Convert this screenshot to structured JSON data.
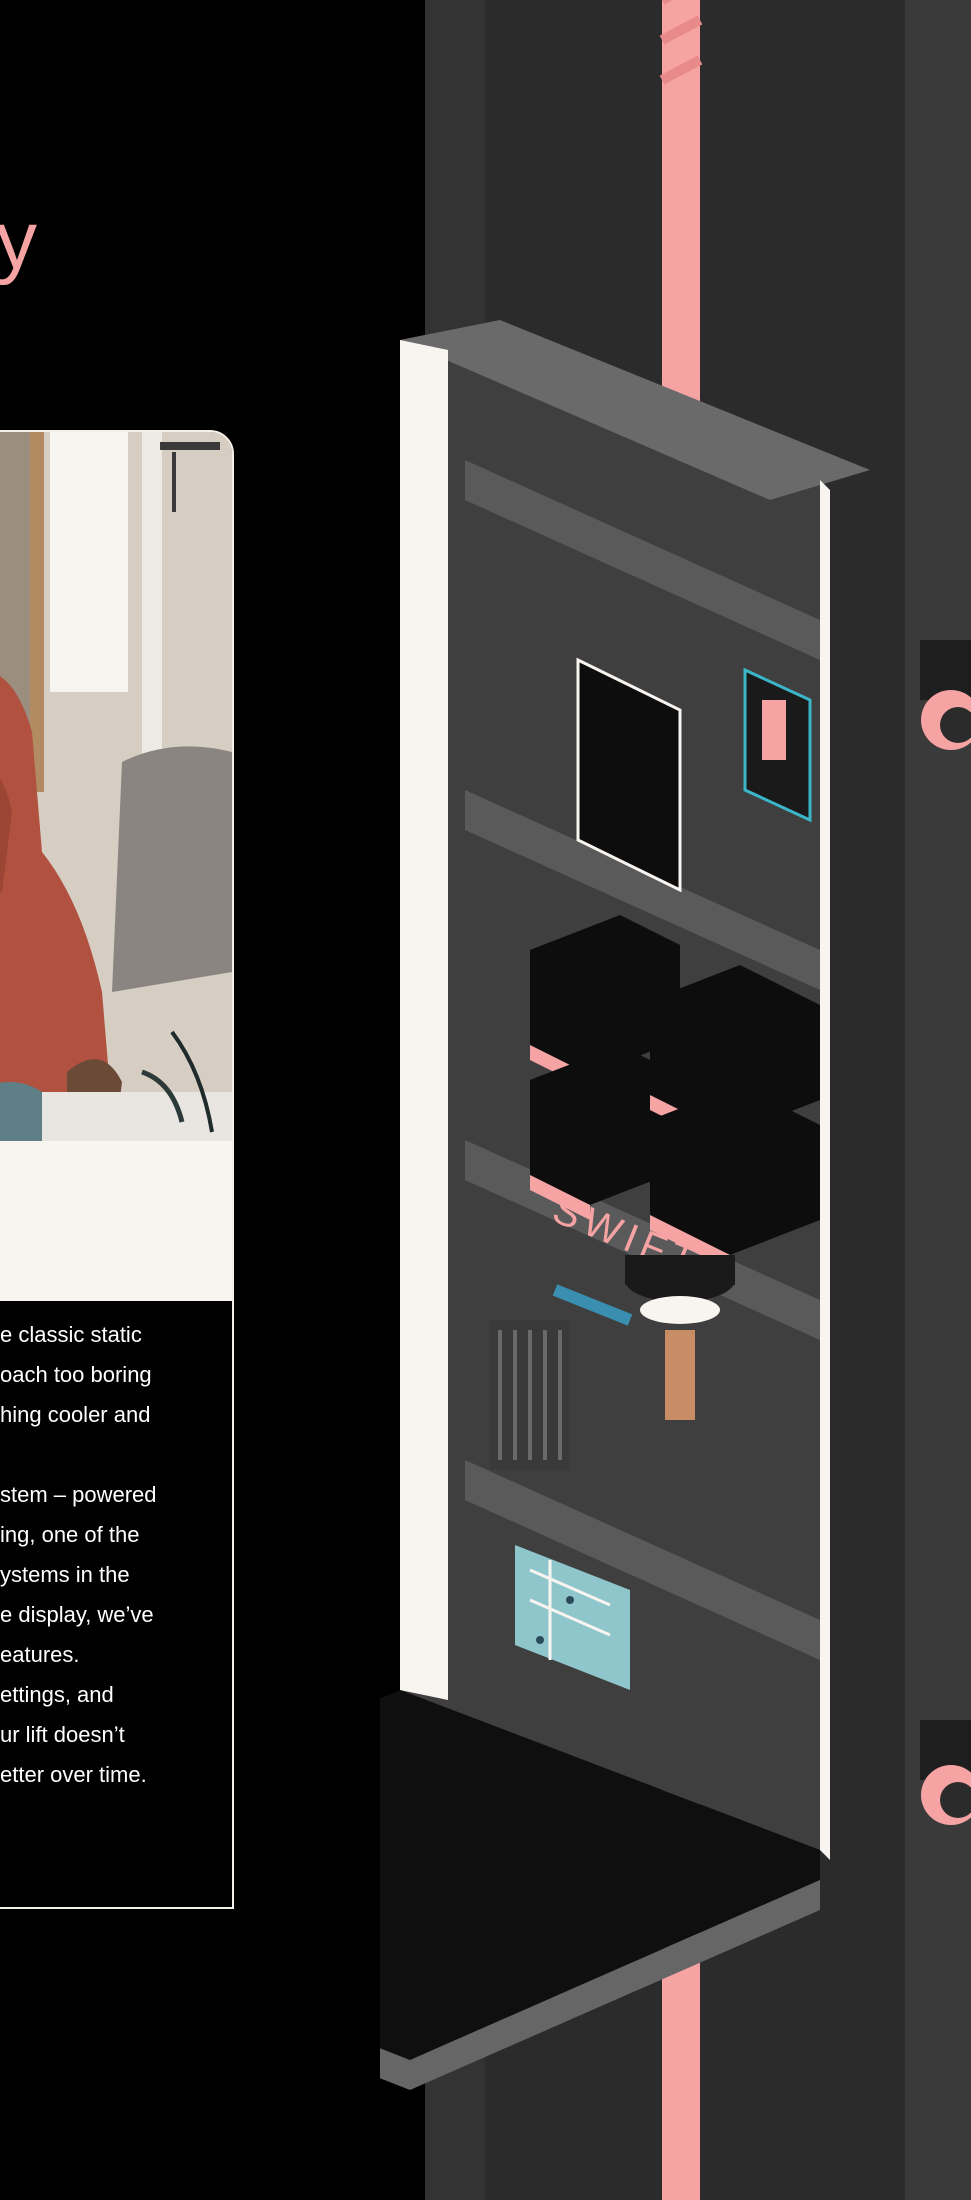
{
  "heading": {
    "fragment": "y"
  },
  "card": {
    "paragraphs": [
      "e classic static\noach too boring\nhing cooler and",
      "stem – powered\ning, one of the\nystems in the\ne display, we’ve\neatures.\nettings, and\nur lift doesn’t\netter over time."
    ]
  },
  "illustration": {
    "panel_label": "SWIFT",
    "colors": {
      "background": "#000000",
      "shaft": "#2b2b2b",
      "cabin": "#4a4a4a",
      "accent_pink": "#f5a3a3",
      "cabin_edge": "#f8f4f0"
    }
  }
}
